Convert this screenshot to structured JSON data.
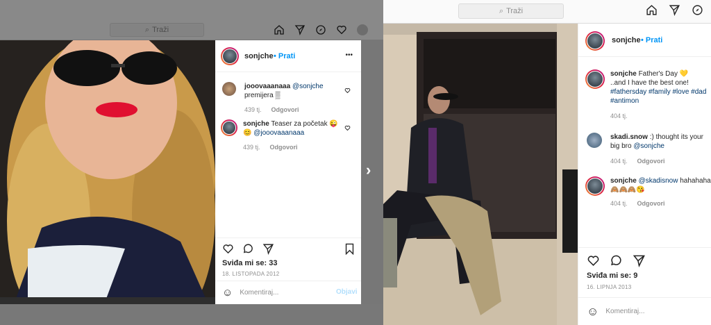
{
  "left_window": {
    "search_placeholder": "Traži",
    "post": {
      "username": "sonjche",
      "follow_label": "• Prati",
      "more_label": "•••",
      "comments": [
        {
          "username": "jooovaaanaaa",
          "mention": "@sonjche",
          "text": "premijera ▒",
          "time": "439 tj.",
          "reply": "Odgovori"
        },
        {
          "username": "sonjche",
          "text": "Teaser za početak 😜",
          "text2_emoji": "😊",
          "mention": "@jooovaaanaaa",
          "time": "439 tj.",
          "reply": "Odgovori"
        }
      ],
      "likes": "Sviđa mi se: 33",
      "date": "18. LISTOPADA 2012",
      "comment_placeholder": "Komentiraj...",
      "post_button": "Objavi"
    }
  },
  "right_window": {
    "search_placeholder": "Traži",
    "post": {
      "username": "sonjche",
      "follow_label": "• Prati",
      "caption": {
        "username": "sonjche",
        "text": "Father's Day 💛",
        "line2": "..and I have the best one!",
        "tags": "#fathersday #family #love #dad",
        "tags2": "#antimon",
        "time": "404 tj."
      },
      "comments": [
        {
          "username": "skadi.snow",
          "text": ":) thought its your",
          "line2_prefix": "big bro",
          "mention": "@sonjche",
          "time": "404 tj.",
          "reply": "Odgovori"
        },
        {
          "username": "sonjche",
          "mention": "@skadisnow",
          "text": "hahahaha",
          "line2": "🙈🙈🙈😘",
          "time": "404 tj.",
          "reply": "Odgovori"
        }
      ],
      "likes": "Sviđa mi se: 9",
      "date": "16. LIPNJA 2013",
      "comment_placeholder": "Komentiraj..."
    }
  },
  "next_arrow": "›",
  "colors": {
    "accent": "#0095f6",
    "mention": "#00376b",
    "muted": "#8e8e8e"
  }
}
